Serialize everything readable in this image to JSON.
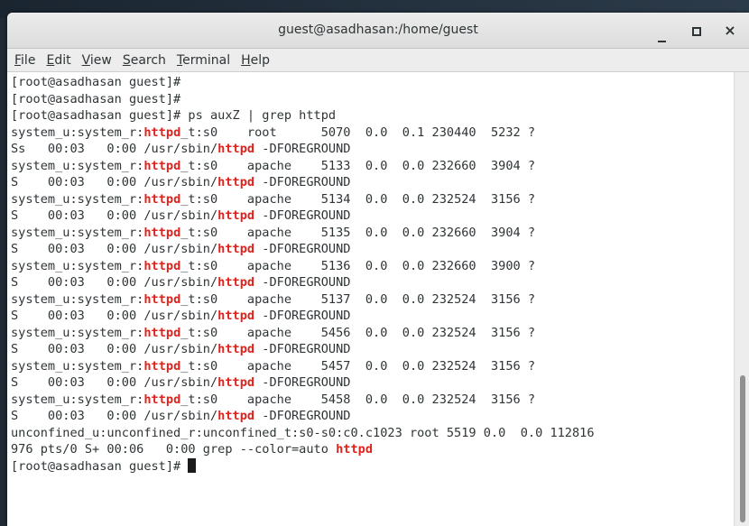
{
  "window": {
    "title": "guest@asadhasan:/home/guest",
    "close_glyph": "×"
  },
  "menu": [
    {
      "key": "F",
      "rest": "ile"
    },
    {
      "key": "E",
      "rest": "dit"
    },
    {
      "key": "V",
      "rest": "iew"
    },
    {
      "key": "S",
      "rest": "earch"
    },
    {
      "key": "T",
      "rest": "erminal"
    },
    {
      "key": "H",
      "rest": "elp"
    }
  ],
  "colors": {
    "match_highlight": "#e0221c",
    "terminal_background": "#ffffff",
    "terminal_foreground": "#2e3436"
  },
  "icons": {
    "minimize": "minimize-icon",
    "maximize": "maximize-icon",
    "close": "close-icon"
  },
  "terminal": {
    "highlight": "httpd",
    "lines": [
      "[root@asadhasan guest]#",
      "[root@asadhasan guest]#",
      "[root@asadhasan guest]# ps auxZ | grep httpd",
      "system_u:system_r:httpd_t:s0    root      5070  0.0  0.1 230440  5232 ?",
      "Ss   00:03   0:00 /usr/sbin/httpd -DFOREGROUND",
      "system_u:system_r:httpd_t:s0    apache    5133  0.0  0.0 232660  3904 ?",
      "S    00:03   0:00 /usr/sbin/httpd -DFOREGROUND",
      "system_u:system_r:httpd_t:s0    apache    5134  0.0  0.0 232524  3156 ?",
      "S    00:03   0:00 /usr/sbin/httpd -DFOREGROUND",
      "system_u:system_r:httpd_t:s0    apache    5135  0.0  0.0 232660  3904 ?",
      "S    00:03   0:00 /usr/sbin/httpd -DFOREGROUND",
      "system_u:system_r:httpd_t:s0    apache    5136  0.0  0.0 232660  3900 ?",
      "S    00:03   0:00 /usr/sbin/httpd -DFOREGROUND",
      "system_u:system_r:httpd_t:s0    apache    5137  0.0  0.0 232524  3156 ?",
      "S    00:03   0:00 /usr/sbin/httpd -DFOREGROUND",
      "system_u:system_r:httpd_t:s0    apache    5456  0.0  0.0 232524  3156 ?",
      "S    00:03   0:00 /usr/sbin/httpd -DFOREGROUND",
      "system_u:system_r:httpd_t:s0    apache    5457  0.0  0.0 232524  3156 ?",
      "S    00:03   0:00 /usr/sbin/httpd -DFOREGROUND",
      "system_u:system_r:httpd_t:s0    apache    5458  0.0  0.0 232524  3156 ?",
      "S    00:03   0:00 /usr/sbin/httpd -DFOREGROUND",
      "unconfined_u:unconfined_r:unconfined_t:s0-s0:c0.c1023 root 5519 0.0  0.0 112816",
      "976 pts/0 S+ 00:06   0:00 grep --color=auto httpd",
      "[root@asadhasan guest]# "
    ]
  }
}
